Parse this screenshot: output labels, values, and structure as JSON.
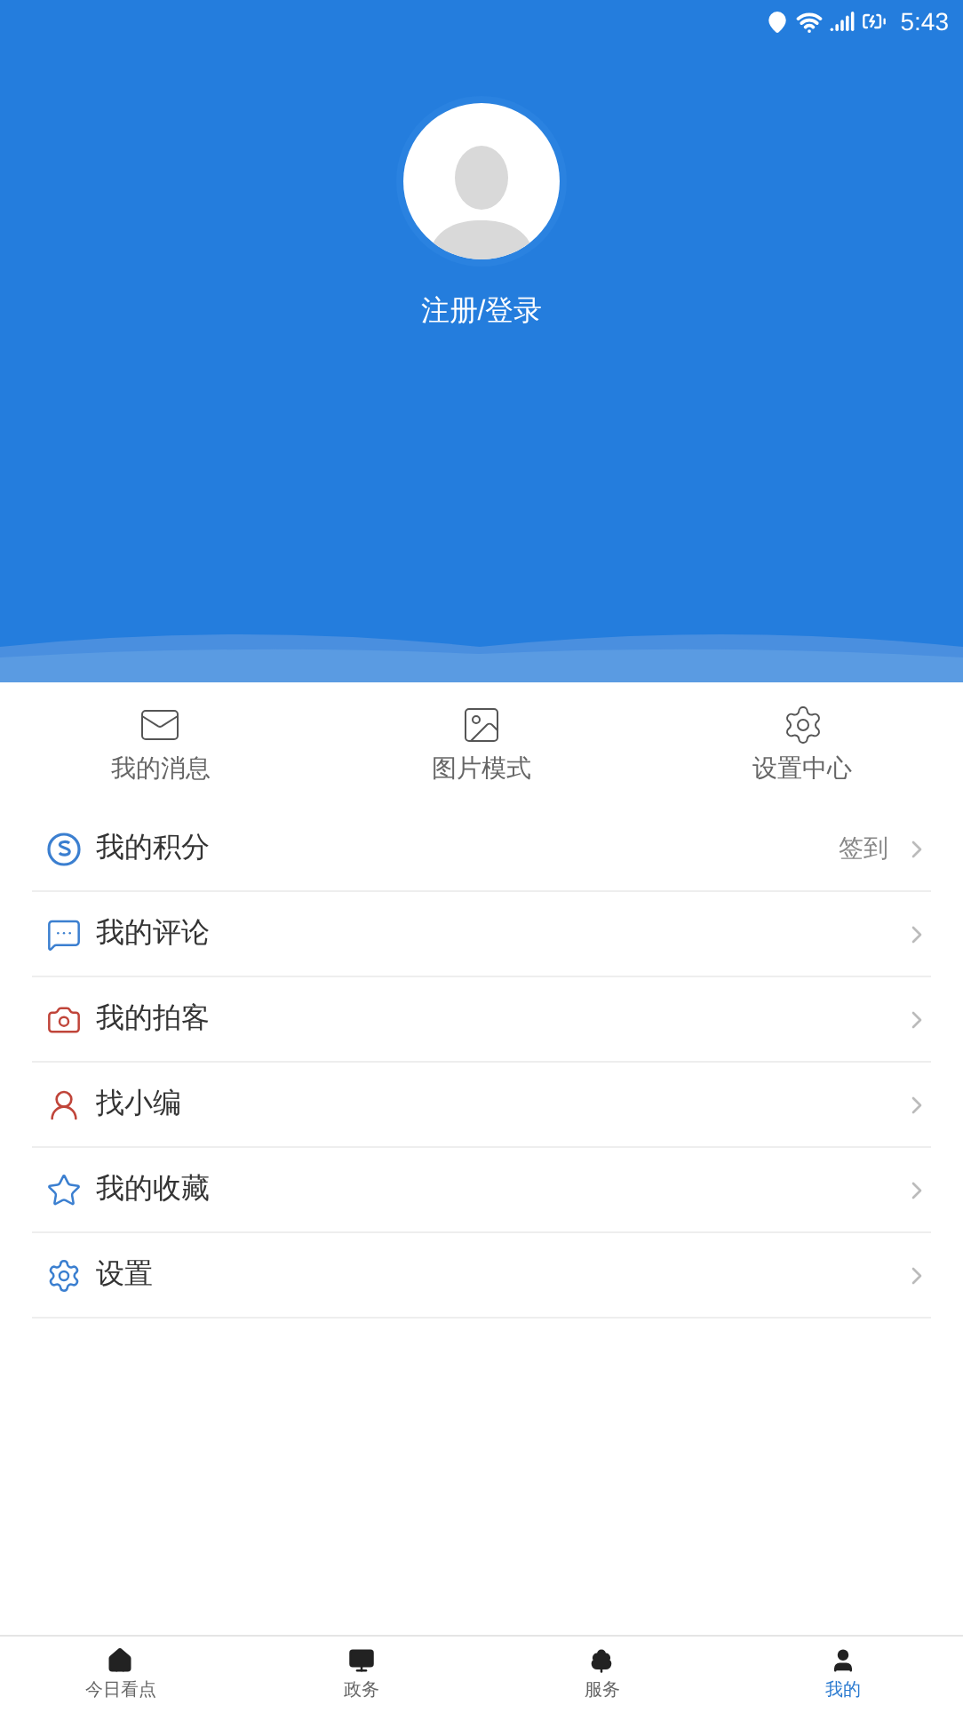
{
  "status_bar": {
    "time": "5:43"
  },
  "profile": {
    "login_label": "注册/登录"
  },
  "quick_actions": [
    {
      "kind": "mail",
      "label": "我的消息"
    },
    {
      "kind": "image",
      "label": "图片模式"
    },
    {
      "kind": "settings",
      "label": "设置中心"
    }
  ],
  "menu": [
    {
      "kind": "points",
      "label": "我的积分",
      "action": "签到"
    },
    {
      "kind": "comments",
      "label": "我的评论"
    },
    {
      "kind": "camera",
      "label": "我的拍客"
    },
    {
      "kind": "editor",
      "label": "找小编"
    },
    {
      "kind": "favorites",
      "label": "我的收藏"
    },
    {
      "kind": "settings",
      "label": "设置"
    }
  ],
  "tab_bar": [
    {
      "kind": "home",
      "label": "今日看点",
      "selected": false
    },
    {
      "kind": "affairs",
      "label": "政务",
      "selected": false
    },
    {
      "kind": "services",
      "label": "服务",
      "selected": false
    },
    {
      "kind": "mine",
      "label": "我的",
      "selected": true
    }
  ]
}
